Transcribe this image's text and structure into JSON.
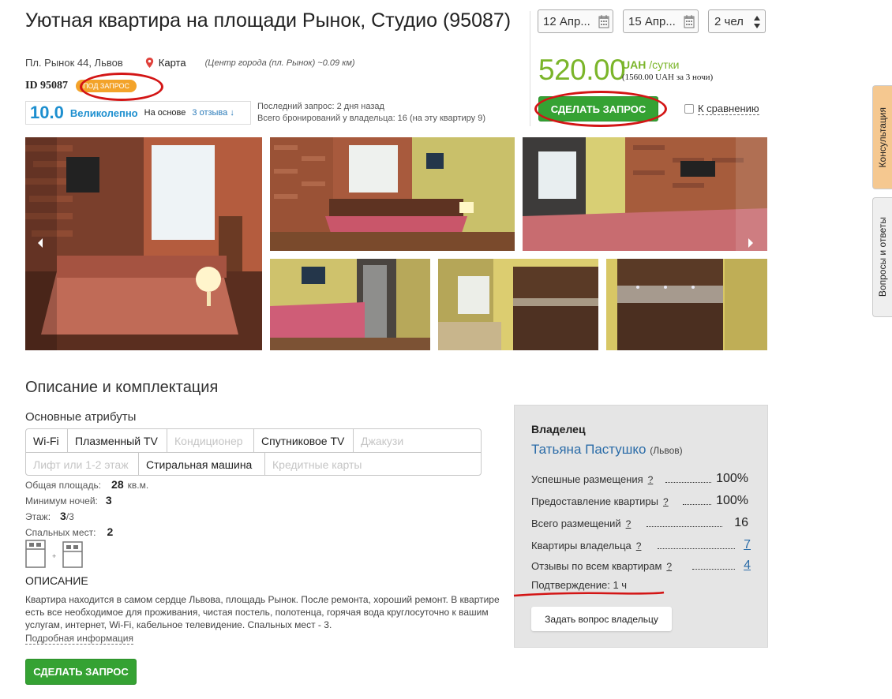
{
  "listing": {
    "title": "Уютная квартира на площади Рынок, Студио (95087)",
    "address": "Пл. Рынок 44, Львов",
    "map_label": "Карта",
    "center_note": "(Центр города (пл. Рынок) ~0.09 км)",
    "id_text": "ID 95087",
    "badge": "ПОД ЗАПРОС"
  },
  "rating": {
    "score": "10.0",
    "word": "Великолепно",
    "basis": "На основе",
    "reviews_link": "3 отзыва ↓",
    "last_request": "Последний запрос: 2 дня назад",
    "bookings": "Всего бронирований у владельца: 16 (на эту квартиру 9)"
  },
  "booking": {
    "check_in": "12 Апр...",
    "check_out": "15 Апр...",
    "guests": "2 чел",
    "price": "520.00",
    "currency": "UAH",
    "per": "/сутки",
    "total": "(1560.00 UAH за 3 ночи)",
    "request_button": "СДЕЛАТЬ ЗАПРОС",
    "compare_label": "К сравнению"
  },
  "side_tabs": {
    "consult": "Консультация",
    "faq": "Вопросы и ответы"
  },
  "description": {
    "section_title": "Описание и комплектация",
    "attributes_title": "Основные атрибуты",
    "amenities": [
      {
        "label": "Wi-Fi",
        "available": true
      },
      {
        "label": "Плазменный TV",
        "available": true
      },
      {
        "label": "Кондиционер",
        "available": false
      },
      {
        "label": "Спутниковое TV",
        "available": true
      },
      {
        "label": "Джакузи",
        "available": false
      },
      {
        "label": "Лифт или 1-2 этаж",
        "available": false
      },
      {
        "label": "Стиральная машина",
        "available": true
      },
      {
        "label": "Кредитные карты",
        "available": false
      }
    ],
    "area_label": "Общая площадь:",
    "area_value": "28",
    "area_unit": "кв.м.",
    "min_nights_label": "Минимум ночей:",
    "min_nights_value": "3",
    "floor_label": "Этаж:",
    "floor_value": "3",
    "floor_total": "/3",
    "beds_label": "Спальных мест:",
    "beds_value": "2",
    "heading": "ОПИСАНИЕ",
    "text": "Квартира находится в самом сердце Львова, площадь Рынок. После ремонта, хороший ремонт. В квартире есть все необходимое для проживания, чистая постель, полотенца, горячая вода круглосуточно к вашим услугам, интернет, Wi-Fi, кабельное телевидение. Спальных мест - 3.",
    "more_link": "Подробная информация",
    "request_button": "СДЕЛАТЬ ЗАПРОС"
  },
  "owner": {
    "label": "Владелец",
    "name": "Татьяна Пастушко",
    "city": "(Львов)",
    "stats": [
      {
        "label": "Успешные размещения",
        "value": "100%",
        "link": false
      },
      {
        "label": "Предоставление квартиры",
        "value": "100%",
        "link": false
      },
      {
        "label": "Всего размещений",
        "value": "16",
        "link": false
      },
      {
        "label": "Квартиры владельца",
        "value": "7",
        "link": true
      },
      {
        "label": "Отзывы по всем квартирам",
        "value": "4",
        "link": true
      }
    ],
    "help_mark": "?",
    "confirmation": "Подтверждение: 1 ч",
    "ask_button": "Задать вопрос владельцу"
  },
  "colors": {
    "price_green": "#7bb52a",
    "button_green": "#35a233",
    "link_blue": "#2b6ca8",
    "badge_orange": "#f3a32a",
    "annotation_red": "#d31515"
  }
}
